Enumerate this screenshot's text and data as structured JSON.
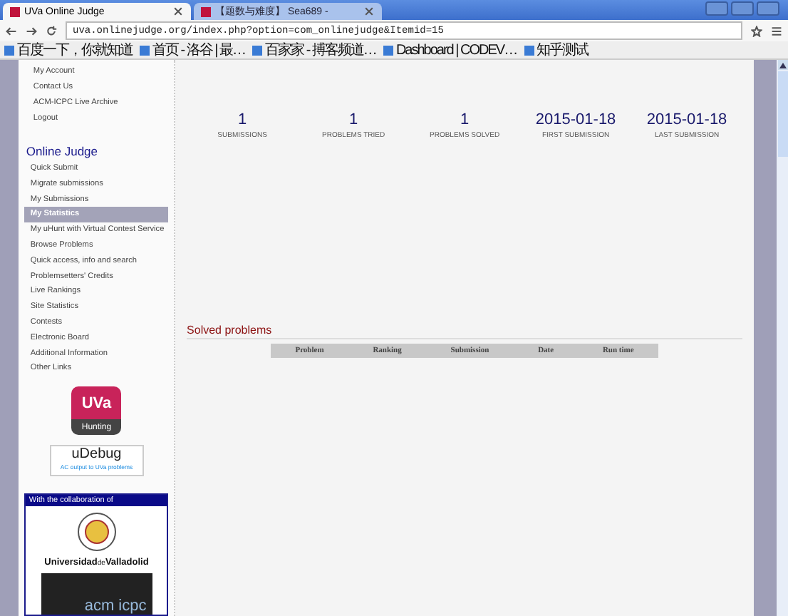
{
  "browser": {
    "tabs": [
      {
        "title": "UVa Online Judge",
        "selected": true
      },
      {
        "title": "【题数与难度】 Sea689 -",
        "selected": false
      }
    ],
    "url": "uva.onlinejudge.org/index.php?option=com_onlinejudge&Itemid=15",
    "bookmarks": [
      "百度一下，你就知道",
      "首页 - 洛谷 | 最…",
      "百家家 - 搏客频道…",
      "Dashboard | CODEV…",
      "知乎测试"
    ]
  },
  "sidebar": {
    "account_links": [
      "My Account",
      "Contact Us",
      "ACM-ICPC Live Archive",
      "Logout"
    ],
    "section_title": "Online Judge",
    "items": [
      {
        "label": "Quick Submit",
        "selected": false
      },
      {
        "label": "Migrate submissions",
        "selected": false
      },
      {
        "label": "My Submissions",
        "selected": false
      },
      {
        "label": "My Statistics",
        "selected": true
      },
      {
        "label": "My uHunt with Virtual Contest Service",
        "selected": false
      },
      {
        "label": "Browse Problems",
        "selected": false
      },
      {
        "label": "Quick access, info and search",
        "selected": false
      },
      {
        "label": "Problemsetters' Credits",
        "selected": false
      },
      {
        "label": "Live Rankings",
        "selected": false
      },
      {
        "label": "Site Statistics",
        "selected": false
      },
      {
        "label": "Contests",
        "selected": false
      },
      {
        "label": "Electronic Board",
        "selected": false
      },
      {
        "label": "Additional Information",
        "selected": false
      },
      {
        "label": "Other Links",
        "selected": false
      }
    ],
    "uhunt": {
      "title": "UVa",
      "subtitle": "Hunting"
    },
    "udebug": {
      "title": "uDebug",
      "subtitle": "AC output to UVa problems"
    },
    "collaboration": {
      "header": "With the collaboration of",
      "university_bold": "Universidad",
      "university_small": "de",
      "university_rest": "Valladolid",
      "acm": "acm icpc"
    }
  },
  "stats": [
    {
      "value": "1",
      "label": "SUBMISSIONS"
    },
    {
      "value": "1",
      "label": "PROBLEMS TRIED"
    },
    {
      "value": "1",
      "label": "PROBLEMS SOLVED"
    },
    {
      "value": "2015-01-18",
      "label": "FIRST SUBMISSION"
    },
    {
      "value": "2015-01-18",
      "label": "LAST SUBMISSION"
    }
  ],
  "solved": {
    "title": "Solved problems",
    "columns": [
      "Problem",
      "Ranking",
      "Submission",
      "Date",
      "Run time"
    ]
  }
}
